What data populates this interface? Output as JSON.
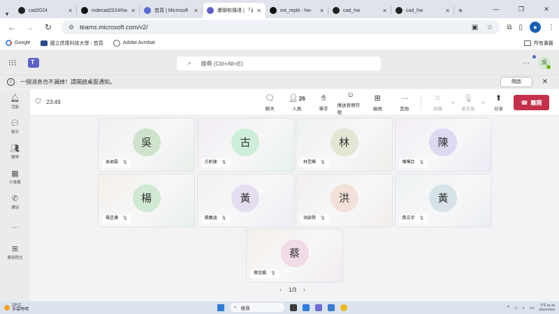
{
  "browser": {
    "tabs": [
      {
        "title": "cad2024",
        "icon": "notion-icon",
        "active": false
      },
      {
        "title": "mdecad2024/hw",
        "icon": "github-icon",
        "active": false
      },
      {
        "title": "首頁 | Microsoft",
        "icon": "microsoft-icon",
        "active": false
      },
      {
        "title": "畫聊和傳達 | 「通",
        "icon": "teams-icon",
        "active": true
      },
      {
        "title": "init_replit - hw-",
        "icon": "github-icon",
        "active": false
      },
      {
        "title": "cad_hw",
        "icon": "notion-icon",
        "active": false
      },
      {
        "title": "cad_hw",
        "icon": "notion-icon",
        "active": false
      }
    ],
    "url": "teams.microsoft.com/v2/",
    "profile_initial": "●",
    "bookmarks": [
      {
        "label": "Google",
        "icon": "google-icon"
      },
      {
        "label": "國立虎尾科技大學 - 首頁",
        "icon": "school-icon"
      },
      {
        "label": "Adobe Acrobat",
        "icon": "acrobat-icon"
      }
    ],
    "all_bookmarks": "所有書籤"
  },
  "teams": {
    "search_placeholder": "搜尋 (Ctrl+Alt+E)",
    "user_initial": "吳",
    "banner": {
      "text": "一個消息也不漏掉！請開啟桌面通知。",
      "button": "開啟"
    },
    "rail": [
      {
        "label": "活動",
        "icon": "bell-icon"
      },
      {
        "label": "聊天",
        "icon": "chat-icon"
      },
      {
        "label": "團隊",
        "icon": "teams-icon"
      },
      {
        "label": "行事曆",
        "icon": "calendar-icon"
      },
      {
        "label": "通話",
        "icon": "phone-icon"
      },
      {
        "label": "",
        "icon": "more-icon"
      },
      {
        "label": "應用程式",
        "icon": "apps-icon"
      }
    ],
    "meeting": {
      "timer": "23:49",
      "people_count": "26",
      "controls": {
        "chat": "聊天",
        "people": "人員",
        "raise": "舉手",
        "react": "傳送表情符號",
        "view": "檢視",
        "more": "其他",
        "camera": "相機",
        "mic": "麥克風",
        "share": "分享",
        "leave": "離開"
      },
      "participants": [
        {
          "initial": "吳",
          "name": "吳昶霖",
          "avatar_color": "#cfe3cc",
          "bg": "#eef0f2"
        },
        {
          "initial": "古",
          "name": "古昕捷",
          "avatar_color": "#cdeed9",
          "bg": "#f1ecf3"
        },
        {
          "initial": "林",
          "name": "林昱暉",
          "avatar_color": "#e2e6d3",
          "bg": "#eef2f0"
        },
        {
          "initial": "陳",
          "name": "陳暉亞",
          "avatar_color": "#dcd9f1",
          "bg": "#f3eef5"
        },
        {
          "initial": "楊",
          "name": "楊丞濂",
          "avatar_color": "#cfe9d2",
          "bg": "#f4f0ea"
        },
        {
          "initial": "黃",
          "name": "黃鵬涵",
          "avatar_color": "#e5def0",
          "bg": "#f0f3f2"
        },
        {
          "initial": "洪",
          "name": "洪啟舜",
          "avatar_color": "#f1e1d8",
          "bg": "#f2eef2"
        },
        {
          "initial": "黃",
          "name": "黃立宇",
          "avatar_color": "#d8e3e8",
          "bg": "#eef2f3"
        },
        {
          "initial": "蔡",
          "name": "蔡宜輯",
          "avatar_color": "#f0dbe6",
          "bg": "#f4efea"
        }
      ],
      "pager": "1/3"
    }
  },
  "taskbar": {
    "weather_temp": "29°C",
    "weather_text": "多雲時晴",
    "search": "搜尋",
    "time": "下午 01:46",
    "date": "2024/10/23"
  },
  "colors": {
    "teams_purple": "#5b5fc7",
    "leave_red": "#c4314b"
  }
}
